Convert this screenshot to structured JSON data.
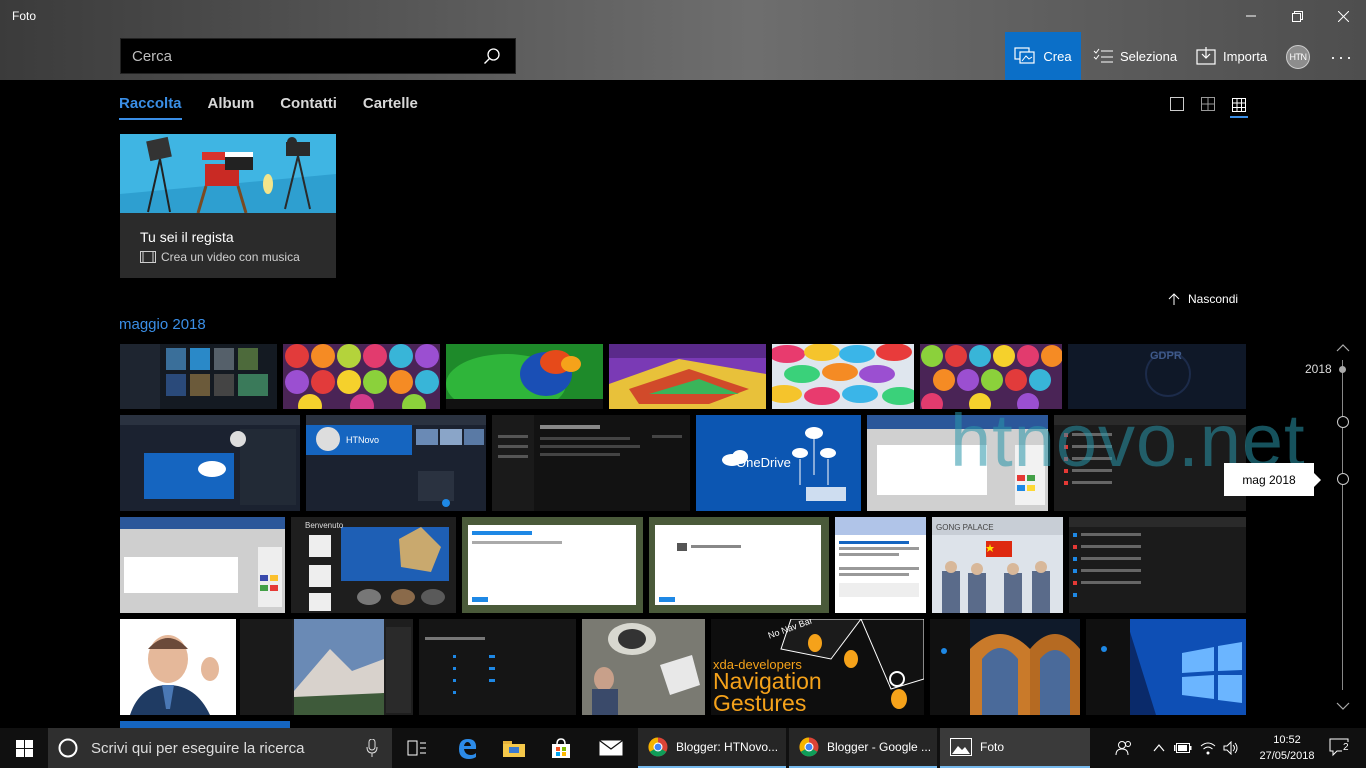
{
  "window": {
    "title": "Foto"
  },
  "search": {
    "placeholder": "Cerca"
  },
  "toolbar": {
    "crea_label": "Crea",
    "seleziona_label": "Seleziona",
    "importa_label": "Importa",
    "avatar_initials": "HTN",
    "more_label": "···"
  },
  "tabs": [
    {
      "label": "Raccolta",
      "active": true
    },
    {
      "label": "Album",
      "active": false
    },
    {
      "label": "Contatti",
      "active": false
    },
    {
      "label": "Cartelle",
      "active": false
    }
  ],
  "promo": {
    "title": "Tu sei il regista",
    "subtitle": "Crea un video con musica"
  },
  "hide_label": "Nascondi",
  "month_heading": "maggio 2018",
  "timeline": {
    "year_label": "2018",
    "tooltip": "mag 2018"
  },
  "watermark": "htnovo.net",
  "photos": {
    "onedrive_label": "OneDrive",
    "htnovo_label": "HTNovo",
    "benvenuto_label": "Benvenuto",
    "gdpr_label": "GDPR",
    "xda_label": "xda-developers",
    "xda_title_1": "Navigation",
    "xda_title_2": "Gestures",
    "nonavbar_label": "No Nav Bar",
    "palace_label": "GONG PALACE"
  },
  "taskbar": {
    "search_placeholder": "Scrivi qui per eseguire la ricerca",
    "apps": [
      {
        "label": "Blogger: HTNovo..."
      },
      {
        "label": "Blogger - Google ..."
      },
      {
        "label": "Foto"
      }
    ],
    "time": "10:52",
    "date": "27/05/2018",
    "notifications_count": "2"
  },
  "colors": {
    "accent": "#0b6fc8",
    "link": "#3a8ee6",
    "taskbar": "#101010"
  }
}
